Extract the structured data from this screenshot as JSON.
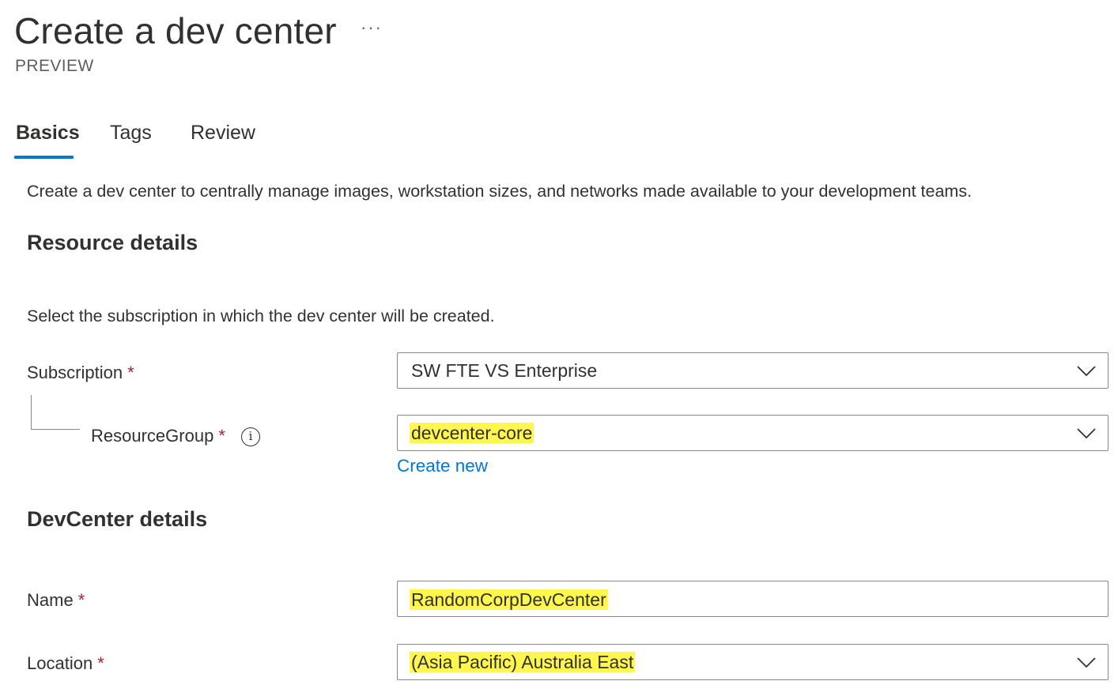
{
  "header": {
    "title": "Create a dev center",
    "more_label": "···",
    "subtitle": "PREVIEW"
  },
  "tabs": [
    {
      "label": "Basics",
      "active": true
    },
    {
      "label": "Tags",
      "active": false
    },
    {
      "label": "Review",
      "active": false
    }
  ],
  "intro": "Create a dev center to centrally manage images, workstation sizes, and networks made available to your development teams.",
  "resource_details": {
    "heading": "Resource details",
    "helper": "Select the subscription in which the dev center will be created.",
    "subscription": {
      "label": "Subscription",
      "required": "*",
      "value": "SW FTE VS Enterprise"
    },
    "resource_group": {
      "label": "ResourceGroup",
      "required": "*",
      "info": "i",
      "value": "devcenter-core",
      "create_new": "Create new"
    }
  },
  "devcenter_details": {
    "heading": "DevCenter details",
    "name": {
      "label": "Name",
      "required": "*",
      "value": "RandomCorpDevCenter"
    },
    "location": {
      "label": "Location",
      "required": "*",
      "value": "(Asia Pacific) Australia East"
    }
  },
  "colors": {
    "accent": "#0078d4",
    "required": "#a4262c",
    "highlight": "#fff74d",
    "border": "#8a8886"
  }
}
